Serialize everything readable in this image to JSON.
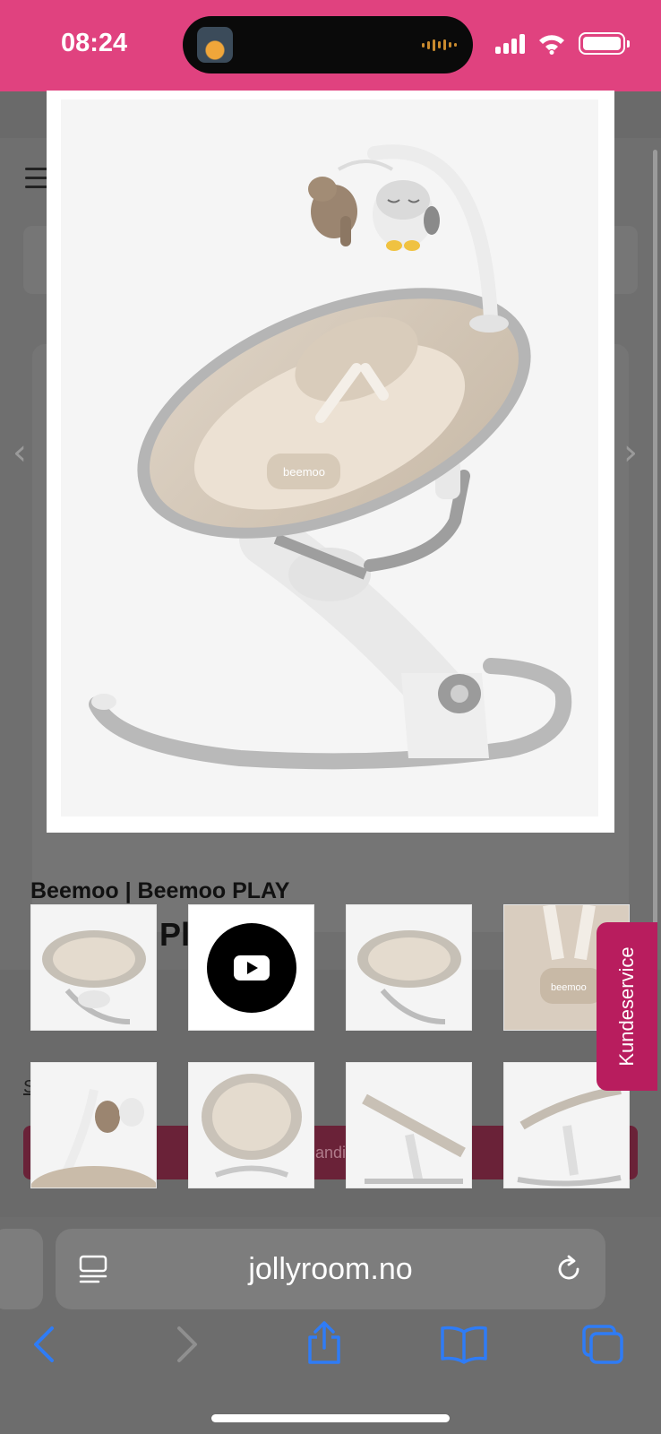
{
  "status_bar": {
    "time": "08:24",
    "colors": {
      "background": "#e0427f"
    },
    "icons": [
      "live-activity-icon",
      "audio-wave-icon",
      "cellular-signal-icon",
      "wifi-icon",
      "battery-icon"
    ]
  },
  "background_page": {
    "brand_line": "Beemoo | Beemoo PLAY",
    "title_fragment": "Pl      ke       sto",
    "link_fragment": "S                k",
    "cart_button_fragment": "andi"
  },
  "modal": {
    "image": "baby-bouncer-main-image"
  },
  "thumbnails": [
    {
      "label": "bouncer-front-view"
    },
    {
      "label": "product-video",
      "icon": "play-icon"
    },
    {
      "label": "bouncer-front-view-2"
    },
    {
      "label": "bouncer-seat-closeup"
    },
    {
      "label": "bouncer-mobile-toys"
    },
    {
      "label": "bouncer-top-view"
    },
    {
      "label": "bouncer-side-recline"
    },
    {
      "label": "bouncer-side-view"
    }
  ],
  "kundeservice": {
    "label": "Kundeservice",
    "color": "#b81d5e"
  },
  "safari": {
    "url": "jollyroom.no",
    "toolbar": [
      "back-icon",
      "forward-icon",
      "share-icon",
      "bookmarks-icon",
      "tabs-icon"
    ]
  }
}
